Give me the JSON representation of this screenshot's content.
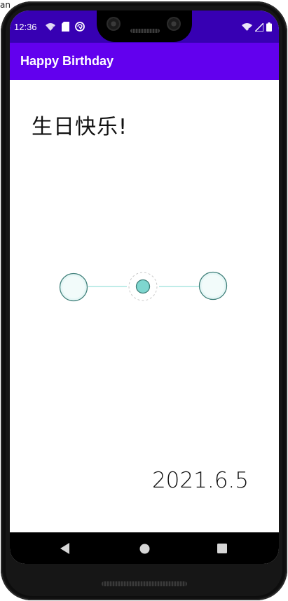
{
  "corner_label": "an",
  "status_bar": {
    "time": "12:36",
    "left_icons": [
      "wifi-question-icon",
      "sd-card-icon",
      "sync-circle-icon"
    ],
    "right_icons": [
      "wifi-x-icon",
      "signal-icon",
      "battery-icon"
    ]
  },
  "app_bar": {
    "title": "Happy Birthday"
  },
  "main": {
    "greeting": "生日快乐!",
    "date": "2021.6.5",
    "indicator": {
      "dot_count": 3,
      "selected_index": 1,
      "colors": {
        "dot_fill": "#e6f7f6",
        "dot_stroke": "#3f7f79",
        "selected_fill": "#7ed6cf",
        "line": "#7fd8d2",
        "dashed_ring": "#c9c9c9"
      }
    }
  },
  "nav_bar": {
    "items": [
      "back-icon",
      "home-icon",
      "recents-icon"
    ]
  },
  "colors": {
    "status_bar": "#3700b3",
    "app_bar": "#6200ee"
  }
}
